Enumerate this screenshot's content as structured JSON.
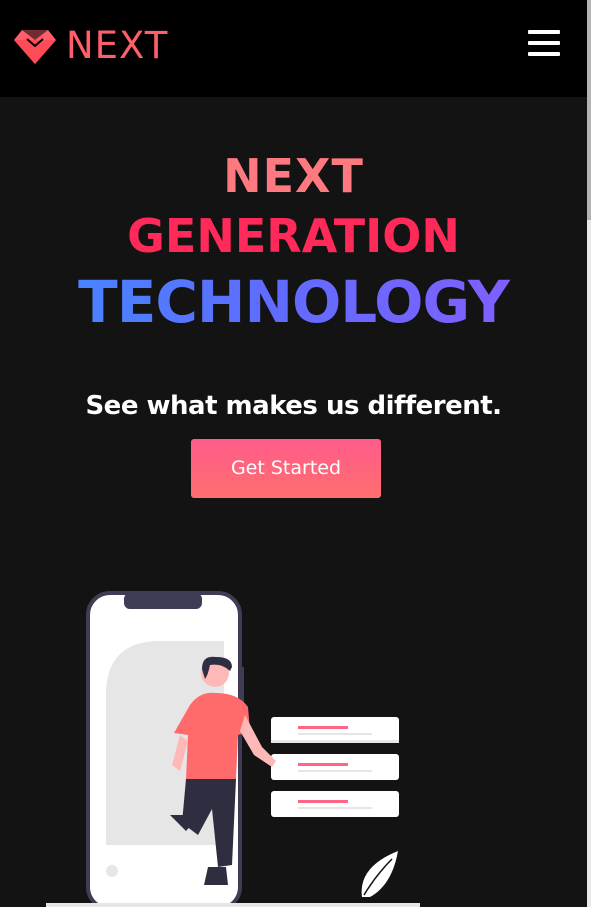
{
  "header": {
    "brand": "NEXT",
    "logo_icon": "diamond-icon",
    "menu_icon": "hamburger-icon"
  },
  "hero": {
    "headline_line1": "NEXT",
    "headline_line2": "GENERATION",
    "headline_line3": "TECHNOLOGY",
    "subheading": "See what makes us different.",
    "cta_label": "Get Started",
    "illustration": "person-with-phone-illustration"
  },
  "colors": {
    "brand_coral": "#ff5e6a",
    "headline_line1": "#ff7a80",
    "headline_line2": "#ff2a5a",
    "headline_line3_gradient": [
      "#3f8dff",
      "#8a5cff"
    ],
    "button_gradient": [
      "#ff5c8a",
      "#ff6e6e"
    ],
    "navbar_bg": "#000000",
    "page_bg": "#131313"
  }
}
